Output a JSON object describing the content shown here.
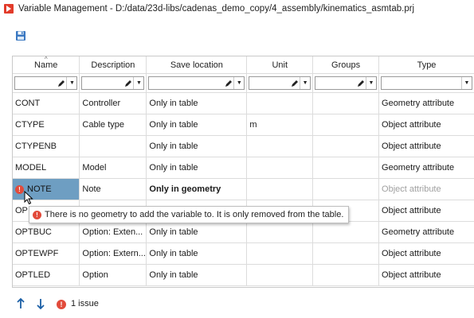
{
  "window": {
    "title": "Variable Management - D:/data/23d-libs/cadenas_demo_copy/4_assembly/kinematics_asmtab.prj"
  },
  "icons": {
    "app": "app-icon",
    "save": "save-icon",
    "filter_edit": "pencil-icon",
    "filter_dropdown": "chevron-down-icon",
    "error": "error-icon",
    "move_up": "arrow-up-icon",
    "move_down": "arrow-down-icon"
  },
  "colors": {
    "selection": "#6e9ec2",
    "error": "#e24b3b",
    "arrows": "#1b5fa6"
  },
  "table": {
    "columns": [
      "Name",
      "Description",
      "Save location",
      "Unit",
      "Groups",
      "Type"
    ],
    "sorted_column": "Name",
    "rows": [
      {
        "name": "CONT",
        "description": "Controller",
        "save_location": "Only in table",
        "unit": "",
        "groups": "",
        "type": "Geometry attribute"
      },
      {
        "name": "CTYPE",
        "description": "Cable type",
        "save_location": "Only in table",
        "unit": "m",
        "groups": "",
        "type": "Object attribute"
      },
      {
        "name": "CTYPENB",
        "description": "",
        "save_location": "Only in table",
        "unit": "",
        "groups": "",
        "type": "Object attribute"
      },
      {
        "name": "MODEL",
        "description": "Model",
        "save_location": "Only in table",
        "unit": "",
        "groups": "",
        "type": "Geometry attribute"
      },
      {
        "name": "NOTE",
        "description": "Note",
        "save_location": "Only in geometry",
        "unit": "",
        "groups": "",
        "type": "Object attribute",
        "selected": true,
        "error": true
      },
      {
        "name": "OP",
        "description": "",
        "save_location": "",
        "unit": "",
        "groups": "",
        "type": "Object attribute"
      },
      {
        "name": "OPTBUC",
        "description": "Option: Exten...",
        "save_location": "Only in table",
        "unit": "",
        "groups": "",
        "type": "Geometry attribute"
      },
      {
        "name": "OPTEWPF",
        "description": "Option: Extern...",
        "save_location": "Only in table",
        "unit": "",
        "groups": "",
        "type": "Object attribute"
      },
      {
        "name": "OPTLED",
        "description": "Option",
        "save_location": "Only in table",
        "unit": "",
        "groups": "",
        "type": "Object attribute"
      }
    ]
  },
  "tooltip": {
    "text": "There is no geometry to add the variable to. It is only removed from the table."
  },
  "status": {
    "issues_label": "1 issue"
  }
}
